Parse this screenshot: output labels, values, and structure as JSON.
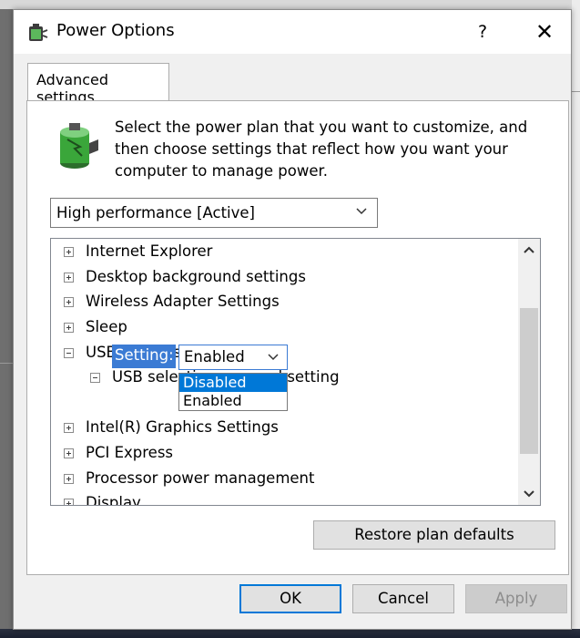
{
  "window": {
    "title": "Power Options",
    "help_label": "?",
    "close_label": "✕"
  },
  "tab": {
    "label": "Advanced settings"
  },
  "intro_text": "Select the power plan that you want to customize, and then choose settings that reflect how you want your computer to manage power.",
  "plan_select": {
    "value": "High performance [Active]"
  },
  "tree": {
    "items": [
      {
        "label": "Internet Explorer",
        "expander": "+"
      },
      {
        "label": "Desktop background settings",
        "expander": "+"
      },
      {
        "label": "Wireless Adapter Settings",
        "expander": "+"
      },
      {
        "label": "Sleep",
        "expander": "+"
      },
      {
        "label": "USB settings",
        "expander": "-"
      },
      {
        "label": "USB selective suspend setting",
        "expander": "-"
      },
      {
        "label": "Intel(R) Graphics Settings",
        "expander": "+"
      },
      {
        "label": "PCI Express",
        "expander": "+"
      },
      {
        "label": "Processor power management",
        "expander": "+"
      },
      {
        "label": "Display",
        "expander": "+"
      }
    ],
    "setting": {
      "label": "Setting:",
      "value": "Enabled",
      "options": [
        "Disabled",
        "Enabled"
      ],
      "highlighted_option": "Disabled"
    }
  },
  "buttons": {
    "restore": "Restore plan defaults",
    "ok": "OK",
    "cancel": "Cancel",
    "apply": "Apply"
  },
  "colors": {
    "accent": "#0078d7",
    "selection": "#3b7bd4"
  }
}
